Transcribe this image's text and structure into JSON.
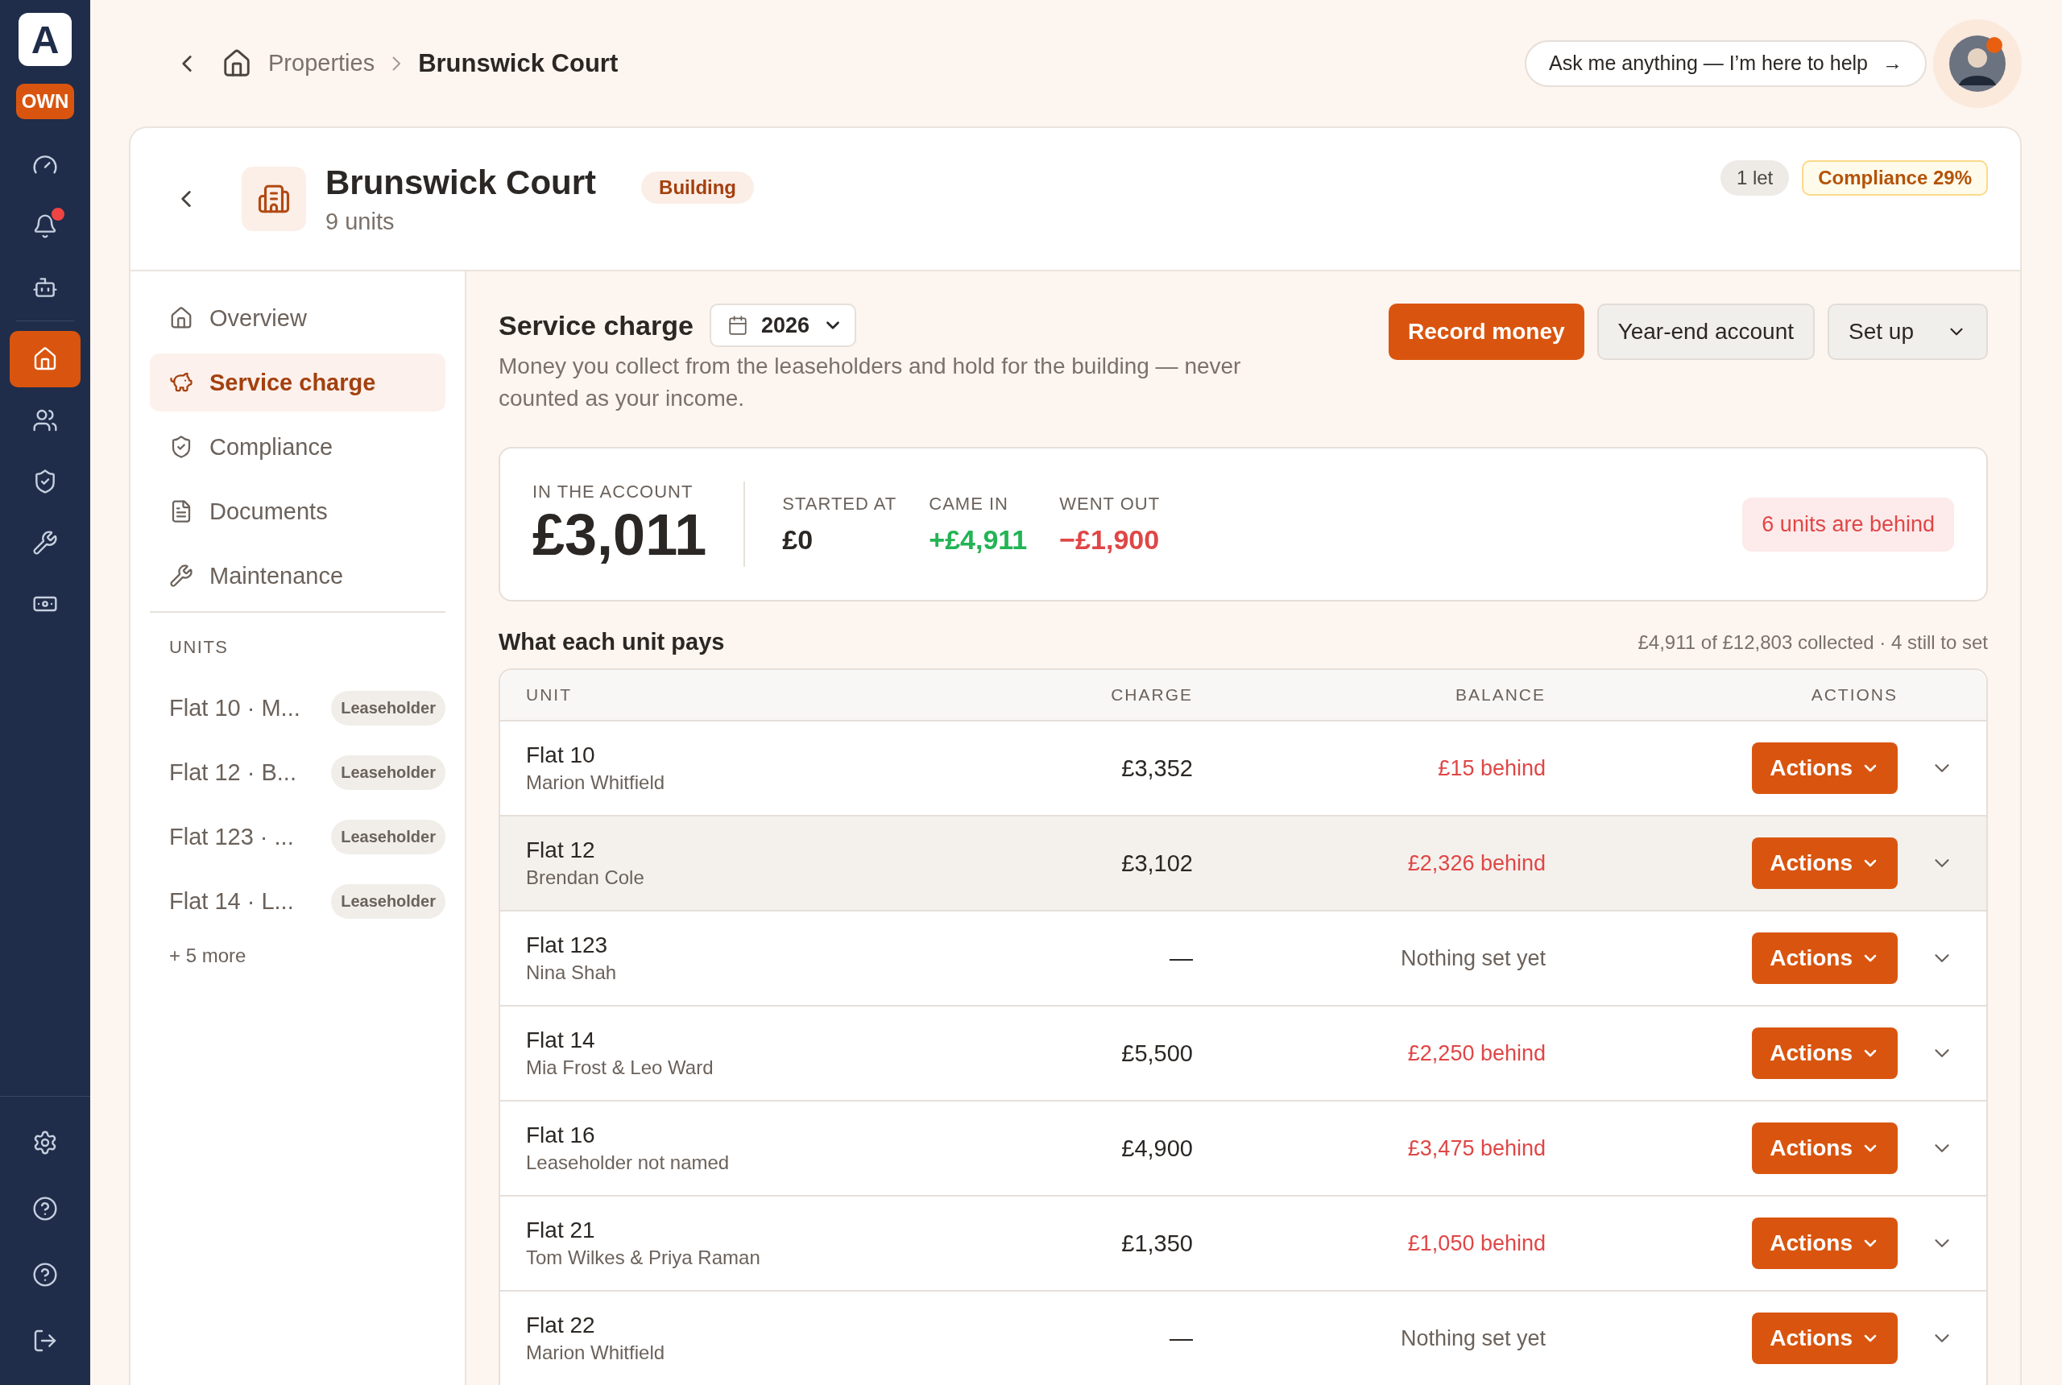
{
  "sidebar": {
    "logo": "A",
    "badge": "OWN",
    "items": [
      {
        "selected": false,
        "alert": false
      },
      {
        "selected": false,
        "alert": true
      },
      {
        "selected": false,
        "alert": false
      },
      {
        "selected": true,
        "alert": false
      },
      {
        "selected": false,
        "alert": false
      },
      {
        "selected": false,
        "alert": false
      },
      {
        "selected": false,
        "alert": false
      },
      {
        "selected": false,
        "alert": false
      }
    ]
  },
  "breadcrumb": {
    "parent": "Properties",
    "current": "Brunswick Court"
  },
  "assistant": {
    "label": "Ask me anything — I’m here to help",
    "arrow": "→"
  },
  "building": {
    "title": "Brunswick Court",
    "tag": "Building",
    "subtitle": "9 units",
    "badges": [
      {
        "label": "1 let",
        "kind": "neutral"
      },
      {
        "label": "Compliance 29%",
        "kind": "warning"
      }
    ]
  },
  "nav": {
    "items": [
      {
        "label": "Overview",
        "selected": false
      },
      {
        "label": "Service charge",
        "selected": true
      },
      {
        "label": "Compliance",
        "selected": false
      },
      {
        "label": "Documents",
        "selected": false
      },
      {
        "label": "Maintenance",
        "selected": false
      }
    ],
    "units_heading": "UNITS",
    "units": [
      {
        "label": "Flat 10 · M...",
        "tag": "Leaseholder"
      },
      {
        "label": "Flat 12 · B...",
        "tag": "Leaseholder"
      },
      {
        "label": "Flat 123 · ...",
        "tag": "Leaseholder"
      },
      {
        "label": "Flat 14 · L...",
        "tag": "Leaseholder"
      }
    ],
    "more": "+ 5 more"
  },
  "section": {
    "title": "Service charge",
    "year": "2026",
    "description": "Money you collect from the leaseholders and hold for the building — never counted as your income.",
    "buttons": [
      {
        "label": "Record money",
        "kind": "primary"
      },
      {
        "label": "Year-end account",
        "kind": "secondary"
      },
      {
        "label": "Set up",
        "kind": "dropdown"
      }
    ]
  },
  "summary": {
    "main_label": "IN THE ACCOUNT",
    "main_value": "£3,011",
    "stats": [
      {
        "label": "STARTED AT",
        "value": "£0",
        "kind": "neutral"
      },
      {
        "label": "CAME IN",
        "value": "+£4,911",
        "kind": "positive"
      },
      {
        "label": "WENT OUT",
        "value": "−£1,900",
        "kind": "negative"
      }
    ],
    "alert": "6 units are behind"
  },
  "table": {
    "title": "What each unit pays",
    "note": "£4,911 of £12,803 collected · 4 still to set",
    "columns": [
      "UNIT",
      "CHARGE",
      "BALANCE",
      "ACTIONS"
    ],
    "rows": [
      {
        "unit": "Flat 10",
        "holder": "Marion Whitfield",
        "charge": "£3,352",
        "balance": "£15 behind",
        "kind": "behind",
        "highlighted": false,
        "action": "Actions"
      },
      {
        "unit": "Flat 12",
        "holder": "Brendan Cole",
        "charge": "£3,102",
        "balance": "£2,326 behind",
        "kind": "behind",
        "highlighted": true,
        "action": "Actions"
      },
      {
        "unit": "Flat 123",
        "holder": "Nina Shah",
        "charge": "—",
        "balance": "Nothing set yet",
        "kind": "unset",
        "highlighted": false,
        "action": "Actions"
      },
      {
        "unit": "Flat 14",
        "holder": "Mia Frost & Leo Ward",
        "charge": "£5,500",
        "balance": "£2,250 behind",
        "kind": "behind",
        "highlighted": false,
        "action": "Actions"
      },
      {
        "unit": "Flat 16",
        "holder": "Leaseholder not named",
        "charge": "£4,900",
        "balance": "£3,475 behind",
        "kind": "behind",
        "highlighted": false,
        "action": "Actions"
      },
      {
        "unit": "Flat 21",
        "holder": "Tom Wilkes & Priya Raman",
        "charge": "£1,350",
        "balance": "£1,050 behind",
        "kind": "behind",
        "highlighted": false,
        "action": "Actions"
      },
      {
        "unit": "Flat 22",
        "holder": "Marion Whitfield",
        "charge": "—",
        "balance": "Nothing set yet",
        "kind": "unset",
        "highlighted": false,
        "action": "Actions"
      }
    ]
  }
}
